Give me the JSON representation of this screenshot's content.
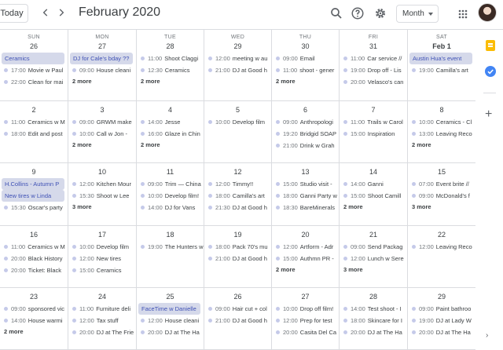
{
  "header": {
    "today_label": "Today",
    "title": "February 2020",
    "view_label": "Month"
  },
  "weekdays": [
    "SUN",
    "MON",
    "TUE",
    "WED",
    "THU",
    "FRI",
    "SAT"
  ],
  "weeks": [
    [
      {
        "day": "26",
        "events": [
          {
            "block": true,
            "title": "Ceramics"
          },
          {
            "time": "17:00",
            "title": "Movie w Paul"
          },
          {
            "time": "22:00",
            "title": "Clean for mai"
          }
        ]
      },
      {
        "day": "27",
        "events": [
          {
            "block": true,
            "title": "DJ for Cale's bday ??"
          },
          {
            "time": "09:00",
            "title": "House cleani"
          }
        ],
        "more": "2 more"
      },
      {
        "day": "28",
        "events": [
          {
            "time": "11:00",
            "title": "Shoot Claggi"
          },
          {
            "time": "12:30",
            "title": "Ceramics"
          }
        ],
        "more": "2 more"
      },
      {
        "day": "29",
        "events": [
          {
            "time": "12:00",
            "title": "meeting w au"
          },
          {
            "time": "21:00",
            "title": "DJ at Good h"
          }
        ]
      },
      {
        "day": "30",
        "events": [
          {
            "time": "09:00",
            "title": "Email"
          },
          {
            "time": "11:00",
            "title": "shoot - gener"
          }
        ],
        "more": "2 more"
      },
      {
        "day": "31",
        "events": [
          {
            "time": "11:00",
            "title": "Car service //"
          },
          {
            "time": "19:00",
            "title": "Drop off - Lis"
          },
          {
            "time": "20:00",
            "title": "Velasco's can"
          }
        ]
      },
      {
        "day": "Feb 1",
        "events": [
          {
            "block": true,
            "title": "Austin Hua's event"
          },
          {
            "time": "19:00",
            "title": "Camilla's art"
          }
        ]
      }
    ],
    [
      {
        "day": "2",
        "events": [
          {
            "time": "11:00",
            "title": "Ceramics w M"
          },
          {
            "time": "18:00",
            "title": "Edit and post"
          }
        ]
      },
      {
        "day": "3",
        "events": [
          {
            "time": "09:00",
            "title": "GRWM make"
          },
          {
            "time": "10:00",
            "title": "Call w Jon -"
          }
        ],
        "more": "2 more"
      },
      {
        "day": "4",
        "events": [
          {
            "time": "14:00",
            "title": "Jesse"
          },
          {
            "time": "16:00",
            "title": "Glaze in Chin"
          }
        ],
        "more": "2 more"
      },
      {
        "day": "5",
        "events": [
          {
            "time": "10:00",
            "title": "Develop film"
          }
        ]
      },
      {
        "day": "6",
        "events": [
          {
            "time": "09:00",
            "title": "Anthropologi"
          },
          {
            "time": "19:20",
            "title": "Bridgid SOAP"
          },
          {
            "time": "21:00",
            "title": "Drink w Grah"
          }
        ]
      },
      {
        "day": "7",
        "events": [
          {
            "time": "11:00",
            "title": "Trails w Carol"
          },
          {
            "time": "15:00",
            "title": "Inspiration"
          }
        ]
      },
      {
        "day": "8",
        "events": [
          {
            "time": "10:00",
            "title": "Ceramics - Cl"
          },
          {
            "time": "13:00",
            "title": "Leaving Reco"
          }
        ],
        "more": "2 more"
      }
    ],
    [
      {
        "day": "9",
        "events": [
          {
            "block": true,
            "title": "H.Collins - Autumn P"
          },
          {
            "block": true,
            "title": "New tires w Linda"
          },
          {
            "time": "15:30",
            "title": "Oscar's party"
          }
        ]
      },
      {
        "day": "10",
        "events": [
          {
            "time": "12:00",
            "title": "Kitchen Mour"
          },
          {
            "time": "15:30",
            "title": "Shoot w Lee"
          }
        ],
        "more": "3 more"
      },
      {
        "day": "11",
        "events": [
          {
            "time": "09:00",
            "title": "Trim — China"
          },
          {
            "time": "10:00",
            "title": "Develop film!"
          },
          {
            "time": "14:00",
            "title": "DJ for Vans"
          }
        ]
      },
      {
        "day": "12",
        "events": [
          {
            "time": "12:00",
            "title": "Timmy!!"
          },
          {
            "time": "18:00",
            "title": "Camilla's art"
          },
          {
            "time": "21:30",
            "title": "DJ at Good h"
          }
        ]
      },
      {
        "day": "13",
        "events": [
          {
            "time": "15:00",
            "title": "Studio visit -"
          },
          {
            "time": "18:00",
            "title": "Ganni Party w"
          },
          {
            "time": "18:30",
            "title": "BareMinerals"
          }
        ]
      },
      {
        "day": "14",
        "events": [
          {
            "time": "14:00",
            "title": "Ganni"
          },
          {
            "time": "15:00",
            "title": "Shoot Camill"
          }
        ],
        "more": "2 more"
      },
      {
        "day": "15",
        "events": [
          {
            "time": "07:00",
            "title": "Event brite //"
          },
          {
            "time": "09:00",
            "title": "McDonald's f"
          }
        ],
        "more": "3 more"
      }
    ],
    [
      {
        "day": "16",
        "events": [
          {
            "time": "11:00",
            "title": "Ceramics w M"
          },
          {
            "time": "20:00",
            "title": "Black History"
          },
          {
            "time": "20:00",
            "title": "Ticket: Black"
          }
        ]
      },
      {
        "day": "17",
        "events": [
          {
            "time": "10:00",
            "title": "Develop film"
          },
          {
            "time": "12:00",
            "title": "New tires"
          },
          {
            "time": "15:00",
            "title": "Ceramics"
          }
        ]
      },
      {
        "day": "18",
        "events": [
          {
            "time": "19:00",
            "title": "The Hunters w"
          }
        ]
      },
      {
        "day": "19",
        "events": [
          {
            "time": "18:00",
            "title": "Pack 70's mu"
          },
          {
            "time": "21:00",
            "title": "DJ at Good h"
          }
        ]
      },
      {
        "day": "20",
        "events": [
          {
            "time": "12:00",
            "title": "Artform - Adr"
          },
          {
            "time": "15:00",
            "title": "Authmn PR -"
          }
        ],
        "more": "2 more"
      },
      {
        "day": "21",
        "events": [
          {
            "time": "09:00",
            "title": "Send Packag"
          },
          {
            "time": "12:00",
            "title": "Lunch w Sere"
          }
        ],
        "more": "3 more"
      },
      {
        "day": "22",
        "events": [
          {
            "time": "12:00",
            "title": "Leaving Reco"
          }
        ]
      }
    ],
    [
      {
        "day": "23",
        "events": [
          {
            "time": "09:00",
            "title": "sponsored vic"
          },
          {
            "time": "14:00",
            "title": "House warmi"
          }
        ],
        "more": "2 more"
      },
      {
        "day": "24",
        "events": [
          {
            "time": "11:00",
            "title": "Furniture deli"
          },
          {
            "time": "12:00",
            "title": "Tax stuff"
          },
          {
            "time": "20:00",
            "title": "DJ at The Frie"
          }
        ]
      },
      {
        "day": "25",
        "events": [
          {
            "block": true,
            "title": "FaceTime w Danielle"
          },
          {
            "time": "12:00",
            "title": "House cleani"
          },
          {
            "time": "20:00",
            "title": "DJ at The Ha"
          }
        ]
      },
      {
        "day": "26",
        "events": [
          {
            "time": "09:00",
            "title": "Hair cut + col"
          },
          {
            "time": "21:00",
            "title": "DJ at Good h"
          }
        ]
      },
      {
        "day": "27",
        "events": [
          {
            "time": "10:00",
            "title": "Drop off film!"
          },
          {
            "time": "12:00",
            "title": "Prep for test"
          },
          {
            "time": "20:00",
            "title": "Casita Del Ca"
          }
        ]
      },
      {
        "day": "28",
        "events": [
          {
            "time": "14:00",
            "title": "Test shoot - I"
          },
          {
            "time": "18:00",
            "title": "Skincare for I"
          },
          {
            "time": "20:00",
            "title": "DJ at The Ha"
          }
        ]
      },
      {
        "day": "29",
        "events": [
          {
            "time": "09:00",
            "title": "Paint bathroo"
          },
          {
            "time": "19:00",
            "title": "DJ at Lady W"
          },
          {
            "time": "20:00",
            "title": "DJ at The Ha"
          }
        ]
      }
    ]
  ],
  "colors": {
    "accent": "#1a73e8",
    "event_block_bg": "#d5d9ea",
    "event_block_text": "#3f51b5",
    "event_dot": "#c5cae9",
    "grid_line": "#dadce0"
  },
  "icons": {
    "prev": "chevron-left-icon",
    "next": "chevron-right-icon",
    "search": "search-icon",
    "help": "help-icon",
    "settings": "gear-icon",
    "apps": "apps-grid-icon",
    "keep": "keep-icon",
    "tasks": "tasks-icon",
    "add": "plus-icon",
    "expand": "chevron-right-icon"
  }
}
